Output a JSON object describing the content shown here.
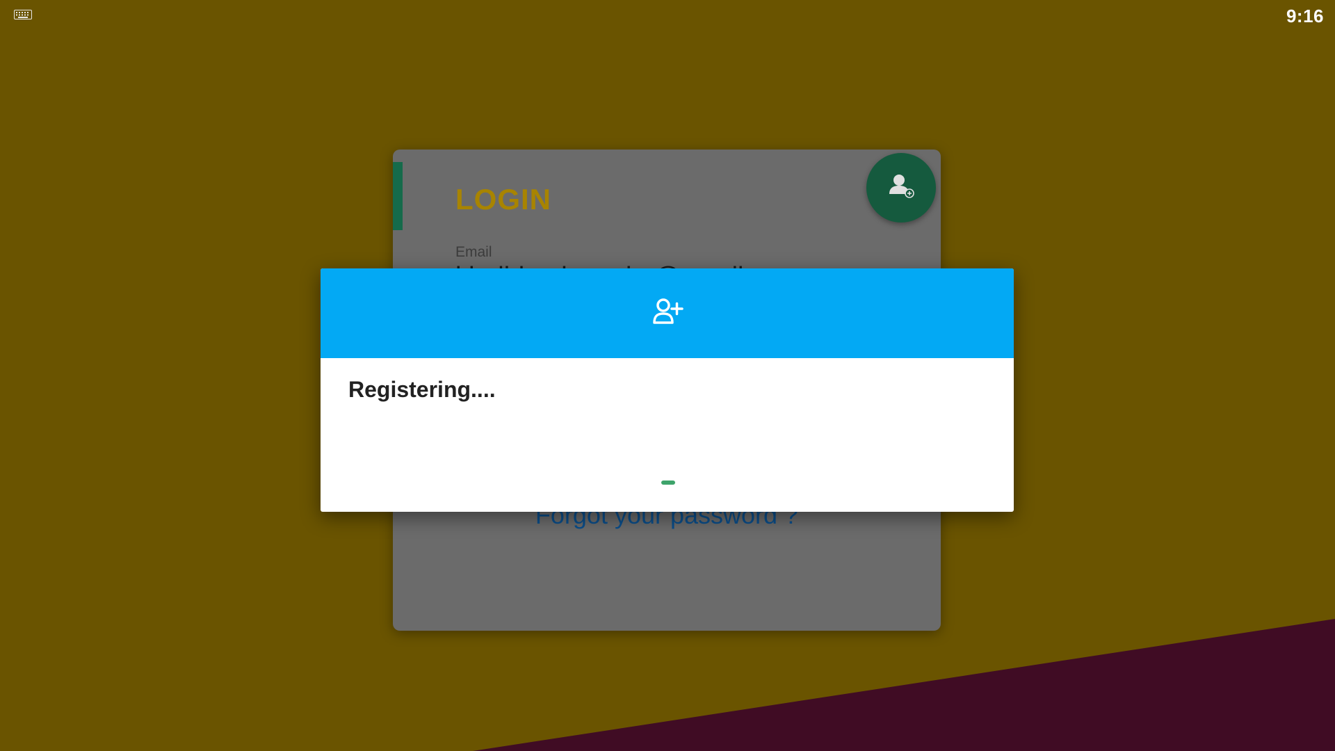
{
  "status_bar": {
    "time": "9:16",
    "keyboard_icon": "keyboard-icon"
  },
  "login": {
    "title": "LOGIN",
    "email_label": "Email",
    "email_value": "khalidmohamcim@gmail.com",
    "forgot_password": "Forgot your password ?",
    "add_user_icon": "user-add-icon"
  },
  "dialog": {
    "header_icon": "user-plus-icon",
    "message": "Registering...."
  },
  "colors": {
    "background": "#6a5400",
    "stripe": "#400c24",
    "dialog_header": "#03a9f4",
    "accent_green": "#156b4b",
    "login_title": "#a88400",
    "link": "#0b4e8a",
    "spinner": "#3ea46b"
  }
}
